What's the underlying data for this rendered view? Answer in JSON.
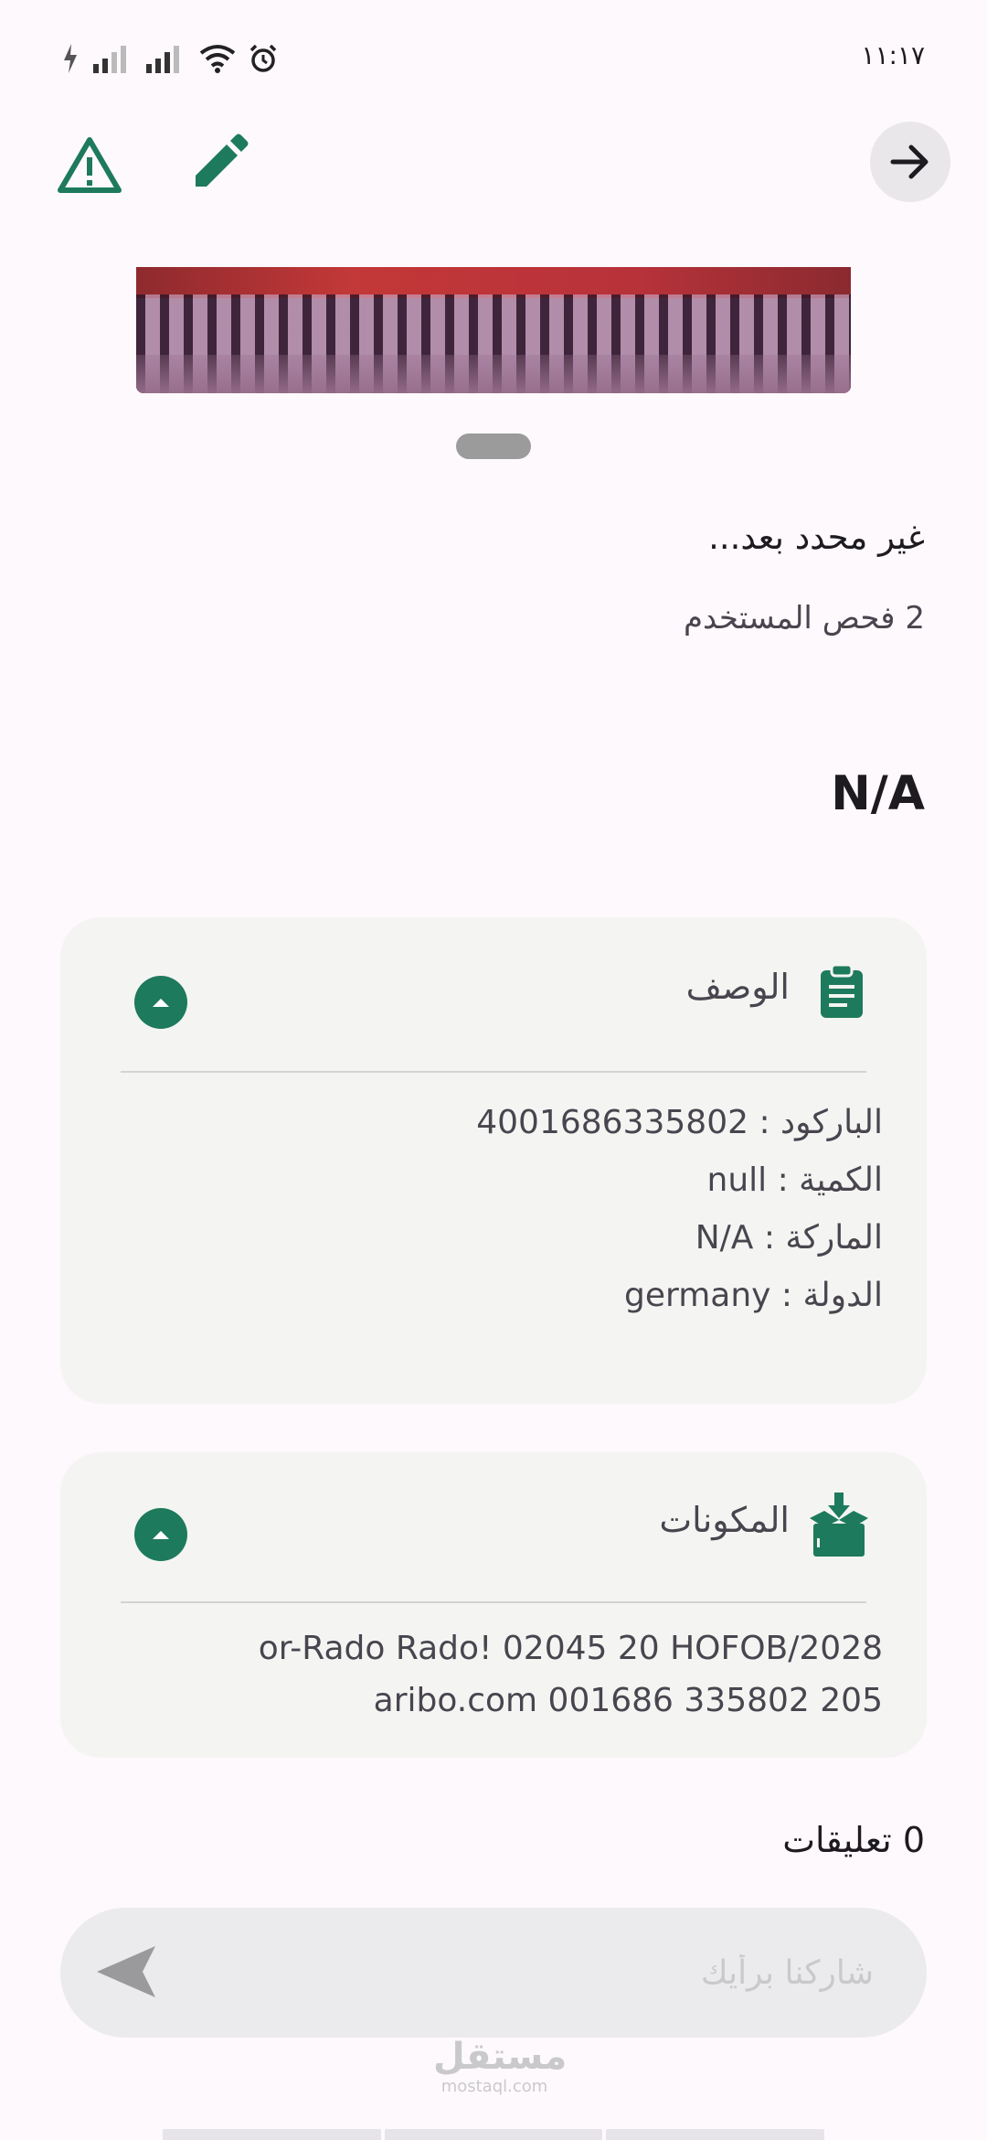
{
  "status_bar": {
    "time": "١١:١٧",
    "icons": [
      "charging-icon",
      "signal-icon",
      "signal-icon",
      "wifi-icon",
      "alarm-icon"
    ]
  },
  "toolbar": {
    "report_icon": "warning-icon",
    "edit_icon": "pencil-icon",
    "back_icon": "arrow-right-icon"
  },
  "product": {
    "status_title": "غير محدد بعد...",
    "scan_count": "2 فحص المستخدم",
    "name": "N/A"
  },
  "description_card": {
    "title": "الوصف",
    "icon": "clipboard-icon",
    "lines": [
      "الباركود : 4001686335802",
      "الكمية : null",
      "الماركة : N/A",
      "الدولة : germany"
    ]
  },
  "ingredients_card": {
    "title": "المكونات",
    "icon": "box-download-icon",
    "lines": [
      "or-Rado Rado! 02045 20 HOFOB/2028",
      "aribo.com 001686 335802 205"
    ]
  },
  "comments": {
    "count_label": "0 تعليقات",
    "placeholder": "شاركنا برأيك",
    "send_icon": "send-icon"
  },
  "watermark": {
    "arabic": "مستقل",
    "latin": "mostaql.com"
  },
  "colors": {
    "accent": "#1e7a5c",
    "background": "#fef9fd",
    "card": "#f4f5f2"
  }
}
